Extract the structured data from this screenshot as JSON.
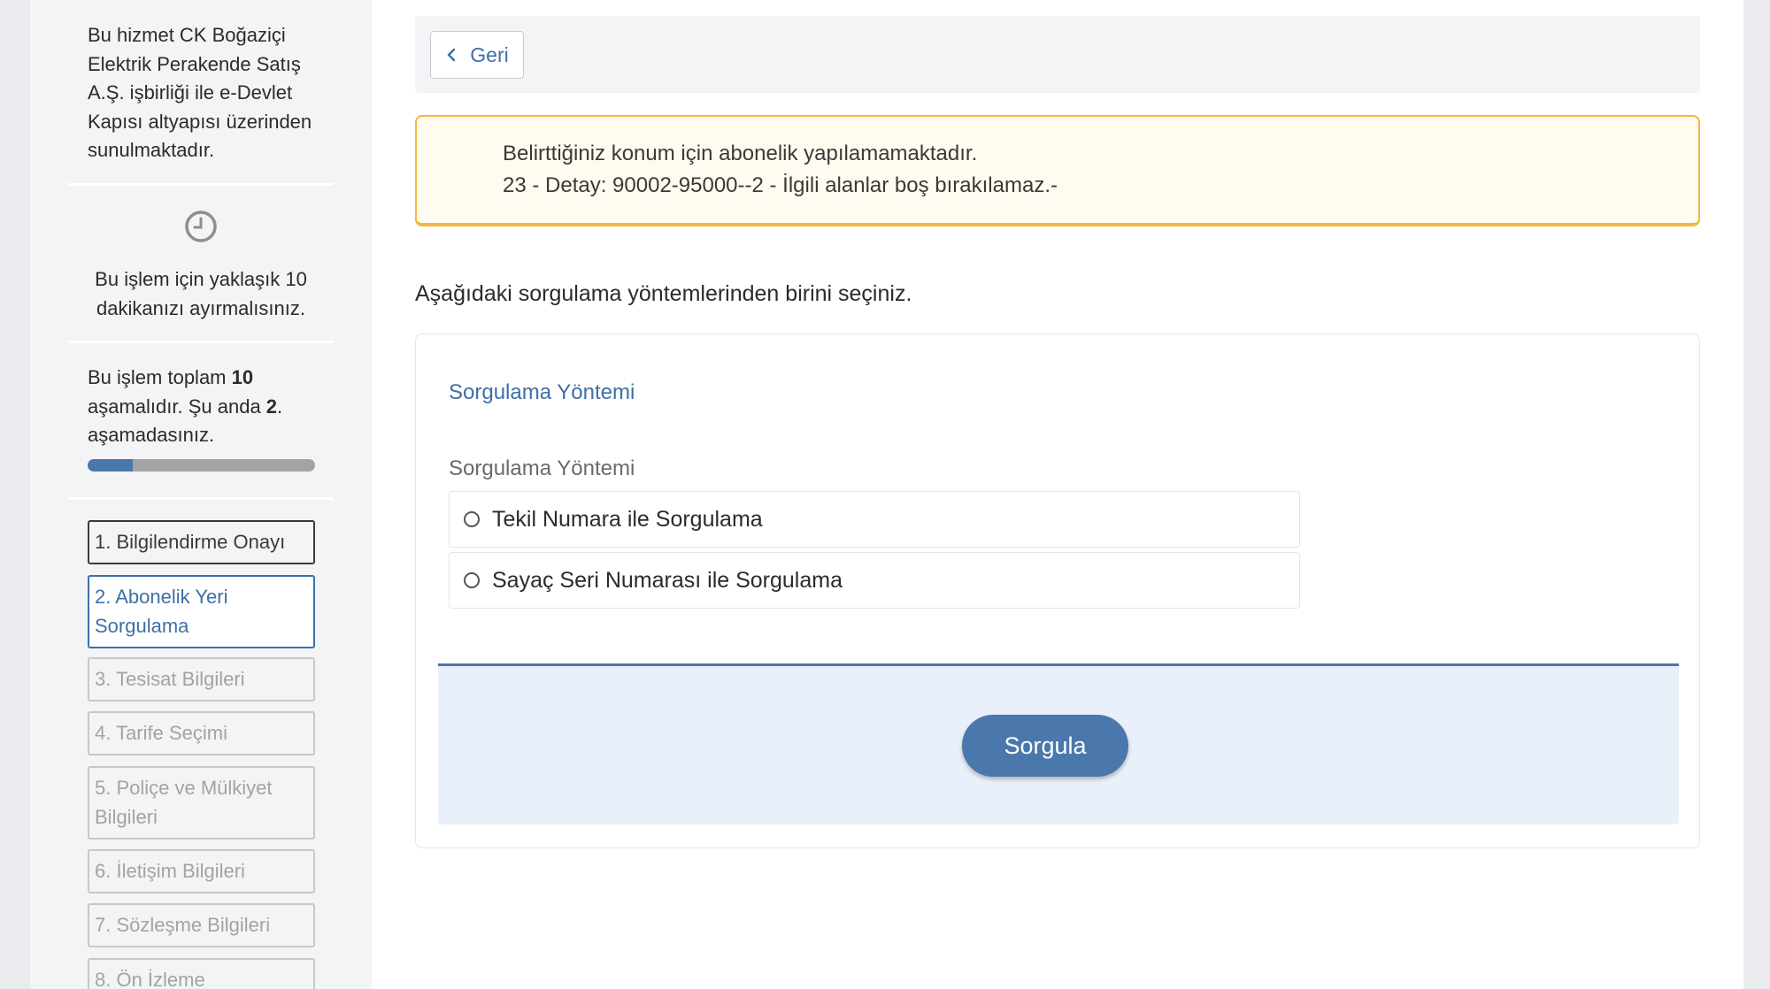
{
  "sidebar": {
    "service_info": "Bu hizmet CK Boğaziçi Elektrik Perakende Satış A.Ş. işbirliği ile e-Devlet Kapısı altyapısı üzerinden sunulmaktadır.",
    "time_icon": "clock-icon",
    "time_info": "Bu işlem için yaklaşık 10 dakikanızı ayırmalısınız.",
    "steps_info": {
      "prefix": "Bu işlem toplam ",
      "total": "10",
      "middle": " aşamalıdır. Şu anda ",
      "current": "2",
      "suffix": ". aşamadasınız."
    },
    "progress_fraction": 0.2,
    "steps": [
      {
        "label": "1. Bilgilendirme Onayı",
        "state": "done"
      },
      {
        "label": "2. Abonelik Yeri Sorgulama",
        "state": "active"
      },
      {
        "label": "3. Tesisat Bilgileri",
        "state": "pending"
      },
      {
        "label": "4. Tarife Seçimi",
        "state": "pending"
      },
      {
        "label": "5. Poliçe ve Mülkiyet Bilgileri",
        "state": "pending"
      },
      {
        "label": "6. İletişim Bilgileri",
        "state": "pending"
      },
      {
        "label": "7. Sözleşme Bilgileri",
        "state": "pending"
      },
      {
        "label": "8. Ön İzleme",
        "state": "pending"
      }
    ]
  },
  "main": {
    "back_label": "Geri",
    "back_icon": "chevron-left-icon",
    "alert": {
      "line1": "Belirttiğiniz konum için abonelik yapılamamaktadır.",
      "line2": "23 - Detay: 90002-95000--2 - İlgili alanlar boş bırakılamaz.-"
    },
    "instruction": "Aşağıdaki sorgulama yöntemlerinden birini seçiniz.",
    "form": {
      "title": "Sorgulama Yöntemi",
      "field_label": "Sorgulama Yöntemi",
      "options": [
        "Tekil Numara ile Sorgulama",
        "Sayaç Seri Numarası ile Sorgulama"
      ],
      "submit_label": "Sorgula"
    }
  },
  "colors": {
    "accent": "#4a77ac",
    "link": "#3d6fa8",
    "alert_border": "#f4b740",
    "alert_bg": "#fffbf0"
  }
}
